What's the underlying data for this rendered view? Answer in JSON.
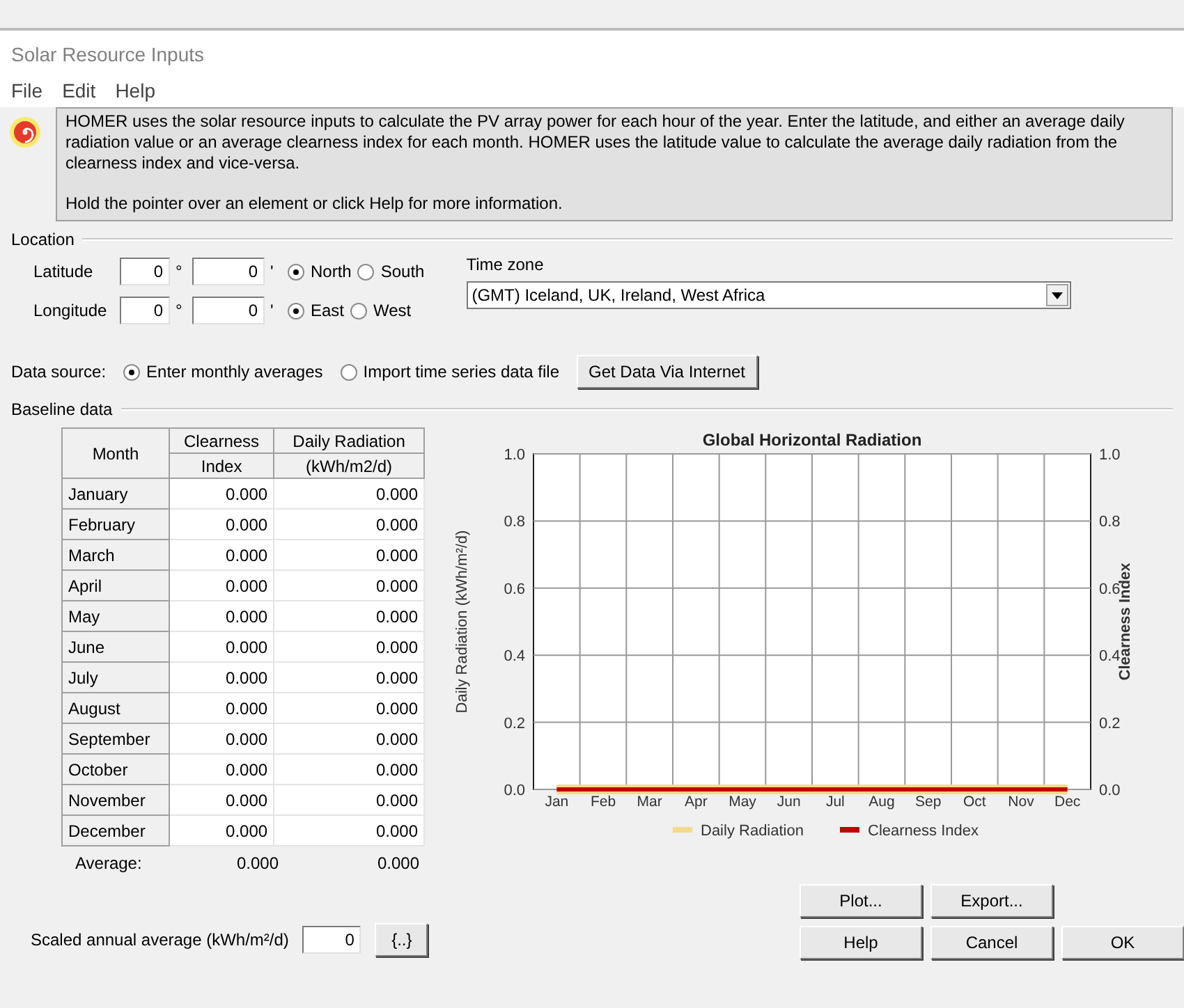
{
  "window": {
    "title": "Solar Resource Inputs"
  },
  "menu": [
    "File",
    "Edit",
    "Help"
  ],
  "info": {
    "paragraphs": [
      "HOMER uses the solar resource inputs to calculate the PV array power for each hour of the year. Enter the latitude, and either an average daily radiation value or an average clearness index for each month. HOMER uses the latitude value to calculate the average daily radiation from the clearness index and vice-versa.",
      "Hold the pointer over an element or click Help for more information."
    ]
  },
  "location": {
    "title": "Location",
    "rows": [
      {
        "label": "Latitude",
        "degrees": "0",
        "degree_mark": "°",
        "minutes": "0",
        "minute_mark": "'",
        "options": [
          {
            "label": "North",
            "selected": true
          },
          {
            "label": "South",
            "selected": false
          }
        ]
      },
      {
        "label": "Longitude",
        "degrees": "0",
        "degree_mark": "°",
        "minutes": "0",
        "minute_mark": "'",
        "options": [
          {
            "label": "East",
            "selected": true
          },
          {
            "label": "West",
            "selected": false
          }
        ]
      }
    ],
    "time_zone": {
      "label": "Time zone",
      "value": "(GMT) Iceland, UK, Ireland, West Africa"
    }
  },
  "data_source": {
    "label": "Data source:",
    "options": [
      {
        "label": "Enter monthly averages",
        "selected": true
      },
      {
        "label": "Import time series data file",
        "selected": false
      }
    ],
    "button": "Get Data Via Internet"
  },
  "baseline": {
    "title": "Baseline data",
    "table": {
      "columns": [
        {
          "lines": [
            "Month"
          ]
        },
        {
          "lines": [
            "Clearness",
            "Index"
          ]
        },
        {
          "lines": [
            "Daily Radiation",
            "(kWh/m2/d)"
          ]
        }
      ],
      "rows": [
        {
          "month": "January",
          "clearness": "0.000",
          "radiation": "0.000"
        },
        {
          "month": "February",
          "clearness": "0.000",
          "radiation": "0.000"
        },
        {
          "month": "March",
          "clearness": "0.000",
          "radiation": "0.000"
        },
        {
          "month": "April",
          "clearness": "0.000",
          "radiation": "0.000"
        },
        {
          "month": "May",
          "clearness": "0.000",
          "radiation": "0.000"
        },
        {
          "month": "June",
          "clearness": "0.000",
          "radiation": "0.000"
        },
        {
          "month": "July",
          "clearness": "0.000",
          "radiation": "0.000"
        },
        {
          "month": "August",
          "clearness": "0.000",
          "radiation": "0.000"
        },
        {
          "month": "September",
          "clearness": "0.000",
          "radiation": "0.000"
        },
        {
          "month": "October",
          "clearness": "0.000",
          "radiation": "0.000"
        },
        {
          "month": "November",
          "clearness": "0.000",
          "radiation": "0.000"
        },
        {
          "month": "December",
          "clearness": "0.000",
          "radiation": "0.000"
        }
      ],
      "average": {
        "label": "Average:",
        "clearness": "0.000",
        "radiation": "0.000"
      }
    },
    "chart_data": {
      "type": "line",
      "title": "Global Horizontal Radiation",
      "ylabel": "Daily Radiation (kWh/m²/d)",
      "y2label": "Clearness Index",
      "categories": [
        "Jan",
        "Feb",
        "Mar",
        "Apr",
        "May",
        "Jun",
        "Jul",
        "Aug",
        "Sep",
        "Oct",
        "Nov",
        "Dec"
      ],
      "series": [
        {
          "name": "Daily Radiation",
          "color": "#f5d98a",
          "values": [
            0,
            0,
            0,
            0,
            0,
            0,
            0,
            0,
            0,
            0,
            0,
            0
          ]
        },
        {
          "name": "Clearness Index",
          "color": "#c00000",
          "values": [
            0,
            0,
            0,
            0,
            0,
            0,
            0,
            0,
            0,
            0,
            0,
            0
          ]
        }
      ],
      "ylim": [
        0,
        1
      ],
      "y2lim": [
        0,
        1
      ],
      "grid": true,
      "legend": true,
      "yticks": [
        {
          "value": 0,
          "label": "0.0"
        },
        {
          "value": 0.2,
          "label": "0.2"
        },
        {
          "value": 0.4,
          "label": "0.4"
        },
        {
          "value": 0.6,
          "label": "0.6"
        },
        {
          "value": 0.8,
          "label": "0.8"
        },
        {
          "value": 1,
          "label": "1.0"
        }
      ],
      "y2ticks": [
        {
          "value": 0,
          "label": "0.0"
        },
        {
          "value": 0.2,
          "label": "0.2"
        },
        {
          "value": 0.4,
          "label": "0.4"
        },
        {
          "value": 0.6,
          "label": "0.6"
        },
        {
          "value": 0.8,
          "label": "0.8"
        },
        {
          "value": 1,
          "label": "1.0"
        }
      ]
    },
    "scaled": {
      "label": "Scaled annual average (kWh/m²/d)",
      "value": "0",
      "button": "{..}"
    }
  },
  "buttons": [
    [
      "Plot...",
      "Export..."
    ],
    [
      "Help",
      "Cancel",
      "OK"
    ]
  ]
}
